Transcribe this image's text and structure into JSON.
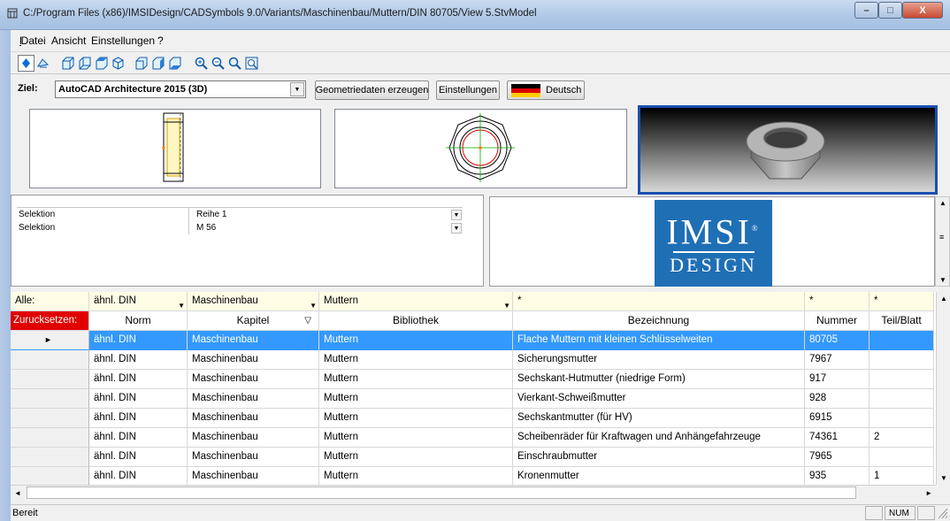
{
  "window": {
    "title": "C:/Program Files (x86)/IMSIDesign/CADSymbols 9.0/Variants/Maschinenbau/Muttern/DIN 80705/View 5.StvModel",
    "minimize": "–",
    "maximize": "□",
    "close": "X"
  },
  "menu": [
    "Datei",
    "Ansicht",
    "Einstellungen",
    "?"
  ],
  "ziel": {
    "label": "Ziel:",
    "target_value": "AutoCAD Architecture 2015 (3D)",
    "geometry_button": "Geometriedaten erzeugen",
    "settings_button": "Einstellungen",
    "language_button": "Deutsch"
  },
  "selection": [
    {
      "label": "Selektion",
      "value": "Reihe 1"
    },
    {
      "label": "Selektion",
      "value": "M 56"
    }
  ],
  "logo": {
    "line1": "IMSI",
    "reg": "®",
    "line2": "DESIGN"
  },
  "filters": {
    "row_label": "Alle:",
    "norm": "ähnl. DIN",
    "kapitel": "Maschinenbau",
    "bibliothek": "Muttern",
    "bezeichnung": "*",
    "nummer": "*",
    "teil": "*"
  },
  "reset_label": "Zurucksetzen:",
  "columns": [
    "Norm",
    "Kapitel",
    "Bibliothek",
    "Bezeichnung",
    "Nummer",
    "Teil/Blatt"
  ],
  "sort_indicator": "▽",
  "selected_marker": "►",
  "rows": [
    {
      "norm": "ähnl. DIN",
      "kapitel": "Maschinenbau",
      "bibliothek": "Muttern",
      "bezeichnung": "Flache Muttern mit kleinen Schlüsselweiten",
      "nummer": "80705",
      "teil": ""
    },
    {
      "norm": "ähnl. DIN",
      "kapitel": "Maschinenbau",
      "bibliothek": "Muttern",
      "bezeichnung": "Sicherungsmutter",
      "nummer": "7967",
      "teil": ""
    },
    {
      "norm": "ähnl. DIN",
      "kapitel": "Maschinenbau",
      "bibliothek": "Muttern",
      "bezeichnung": "Sechskant-Hutmutter (niedrige Form)",
      "nummer": "917",
      "teil": ""
    },
    {
      "norm": "ähnl. DIN",
      "kapitel": "Maschinenbau",
      "bibliothek": "Muttern",
      "bezeichnung": "Vierkant-Schweißmutter",
      "nummer": "928",
      "teil": ""
    },
    {
      "norm": "ähnl. DIN",
      "kapitel": "Maschinenbau",
      "bibliothek": "Muttern",
      "bezeichnung": "Sechskantmutter (für HV)",
      "nummer": "6915",
      "teil": ""
    },
    {
      "norm": "ähnl. DIN",
      "kapitel": "Maschinenbau",
      "bibliothek": "Muttern",
      "bezeichnung": "Scheibenräder für Kraftwagen und Anhängefahrzeuge",
      "nummer": "74361",
      "teil": "2"
    },
    {
      "norm": "ähnl. DIN",
      "kapitel": "Maschinenbau",
      "bibliothek": "Muttern",
      "bezeichnung": "Einschraubmutter",
      "nummer": "7965",
      "teil": ""
    },
    {
      "norm": "ähnl. DIN",
      "kapitel": "Maschinenbau",
      "bibliothek": "Muttern",
      "bezeichnung": "Kronenmutter",
      "nummer": "935",
      "teil": "1"
    }
  ],
  "status": {
    "text": "Bereit",
    "num": "NUM"
  },
  "colors": {
    "selection": "#3399ff",
    "reset_bg": "#e00000",
    "filter_bg": "#fffde6",
    "logo_bg": "#1f6fb5"
  }
}
